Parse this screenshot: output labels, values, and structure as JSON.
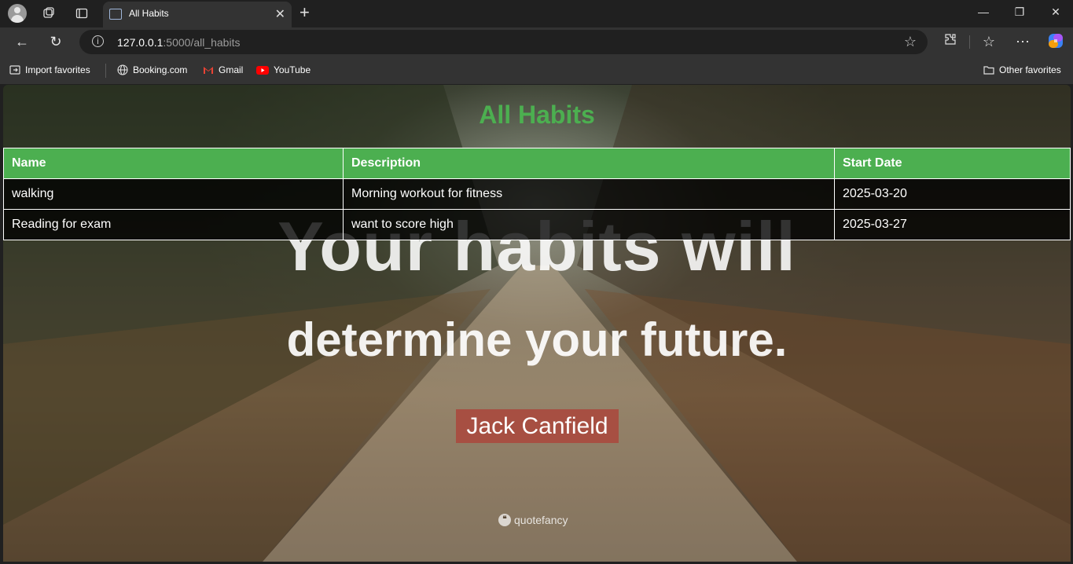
{
  "browser": {
    "tab_title": "All Habits",
    "new_tab_icon": "plus-icon",
    "address": {
      "host": "127.0.0.1",
      "path": ":5000/all_habits"
    },
    "bookmarks": [
      {
        "label": "Import favorites"
      },
      {
        "label": "Booking.com"
      },
      {
        "label": "Gmail"
      },
      {
        "label": "YouTube"
      }
    ],
    "other_favorites": "Other favorites"
  },
  "page": {
    "title": "All Habits",
    "table": {
      "headers": [
        "Name",
        "Description",
        "Start Date"
      ],
      "rows": [
        [
          "walking",
          "Morning workout for fitness",
          "2025-03-20"
        ],
        [
          "Reading for exam",
          "want to score high",
          "2025-03-27"
        ]
      ]
    },
    "background_quote": {
      "line1": "Your habits will",
      "line2": "determine your future.",
      "author": "Jack Canfield",
      "watermark": "quotefancy"
    }
  },
  "colors": {
    "accent": "#4caf50",
    "author_bg": "#aa463c"
  }
}
